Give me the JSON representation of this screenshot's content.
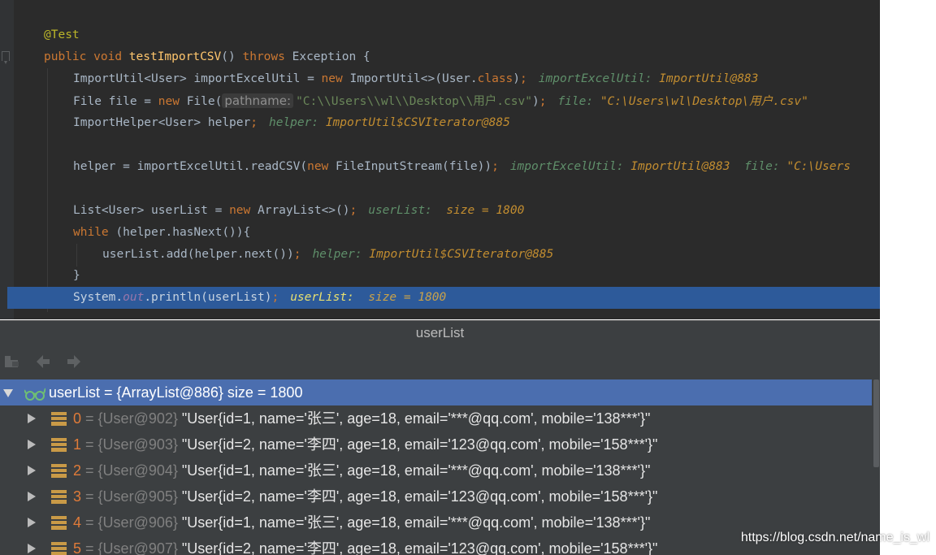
{
  "editor": {
    "lines": [
      {
        "annotation": "@Test"
      },
      {
        "kw1": "public",
        "kw2": "void",
        "method": "testImportCSV",
        "paren": "()",
        "kw3": "throws",
        "type": "Exception",
        "brace": "{"
      },
      {
        "code_a": "ImportUtil<User> importExcelUtil = ",
        "kw": "new",
        "code_b": " ImportUtil<>(User.",
        "kw2": "class",
        "code_c": ")",
        "semi": ";",
        "hint_name": "importExcelUtil:",
        "hint_val": "ImportUtil@883"
      },
      {
        "code_a": "File file = ",
        "kw": "new",
        "code_b": " File(",
        "param_hint": "pathname:",
        "str": "\"C:\\\\Users\\\\wl\\\\Desktop\\\\用户.csv\"",
        "code_c": ")",
        "semi": ";",
        "hint_name": "file:",
        "hint_val": "\"C:\\Users\\wl\\Desktop\\用户.csv\""
      },
      {
        "code_a": "ImportHelper<User> helper",
        "semi": ";",
        "hint_name": "helper:",
        "hint_val": "ImportUtil$CSVIterator@885"
      },
      {
        "code_a": "helper = importExcelUtil.readCSV(",
        "kw": "new",
        "code_b": " FileInputStream(file))",
        "semi": ";",
        "hint_name": "importExcelUtil:",
        "hint_val": "ImportUtil@883",
        "hint2_name": "file:",
        "hint2_val": "\"C:\\Users"
      },
      {
        "code_a": "List<User> userList = ",
        "kw": "new",
        "code_b": " ArrayList<>()",
        "semi": ";",
        "hint_name": "userList:",
        "hint_val": "size = 1800"
      },
      {
        "kw": "while",
        "code_a": " (helper.hasNext()){"
      },
      {
        "code_a": "userList.add(helper.next())",
        "semi": ";",
        "hint_name": "helper:",
        "hint_val": "ImportUtil$CSVIterator@885"
      },
      {
        "code_a": "}"
      },
      {
        "code_a": "System.",
        "field": "out",
        "code_b": ".println(userList)",
        "semi": ";",
        "hint_name": "userList:",
        "hint_val": "size = 1800"
      }
    ]
  },
  "popup": {
    "title": "userList",
    "toolbar": {
      "icons": [
        "show-types-icon",
        "back-icon",
        "forward-icon"
      ]
    },
    "root": {
      "text": "userList = {ArrayList@886}  size = 1800"
    },
    "items": [
      {
        "index": "0",
        "ref": "= {User@902}",
        "value": "\"User{id=1, name='张三', age=18, email='***@qq.com', mobile='138***'}\""
      },
      {
        "index": "1",
        "ref": "= {User@903}",
        "value": "\"User{id=2, name='李四', age=18, email='123@qq.com', mobile='158***'}\""
      },
      {
        "index": "2",
        "ref": "= {User@904}",
        "value": "\"User{id=1, name='张三', age=18, email='***@qq.com', mobile='138***'}\""
      },
      {
        "index": "3",
        "ref": "= {User@905}",
        "value": "\"User{id=2, name='李四', age=18, email='123@qq.com', mobile='158***'}\""
      },
      {
        "index": "4",
        "ref": "= {User@906}",
        "value": "\"User{id=1, name='张三', age=18, email='***@qq.com', mobile='138***'}\""
      },
      {
        "index": "5",
        "ref": "= {User@907}",
        "value": "\"User{id=2, name='李四', age=18, email='123@qq.com', mobile='158***'}\""
      }
    ]
  },
  "watermark": "https://blog.csdn.net/name_is_wl",
  "colors": {
    "editor_bg": "#2b2b2b",
    "keyword": "#cc7832",
    "annotation": "#bbb529",
    "string": "#6a8759",
    "current_line": "#2d5a9a",
    "selected_row": "#4b6eaf",
    "popup_bg": "#3c3f41"
  }
}
